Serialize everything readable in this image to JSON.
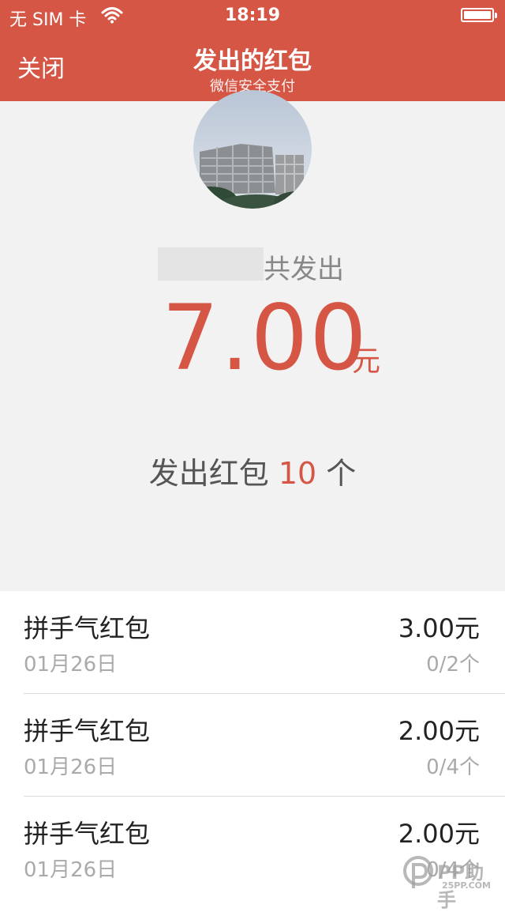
{
  "status_bar": {
    "carrier": "无 SIM 卡",
    "time": "18:19",
    "battery_level": 1.0
  },
  "nav": {
    "close_label": "关闭",
    "title": "发出的红包",
    "subtitle": "微信安全支付"
  },
  "summary": {
    "sent_label": "共发出",
    "amount": "7.00",
    "currency": "元",
    "count_prefix": "发出红包",
    "count": "10",
    "count_suffix": "个"
  },
  "records": [
    {
      "title": "拼手气红包",
      "date": "01月26日",
      "amount": "3.00元",
      "received": "0/2个"
    },
    {
      "title": "拼手气红包",
      "date": "01月26日",
      "amount": "2.00元",
      "received": "0/4个"
    },
    {
      "title": "拼手气红包",
      "date": "01月26日",
      "amount": "2.00元",
      "received": "0/4个"
    }
  ],
  "watermark": {
    "text": "PP助手",
    "sub": "25PP.COM"
  },
  "colors": {
    "accent": "#d65646",
    "summary_bg": "#f3f2f2",
    "muted_text": "#aaaaaa"
  }
}
